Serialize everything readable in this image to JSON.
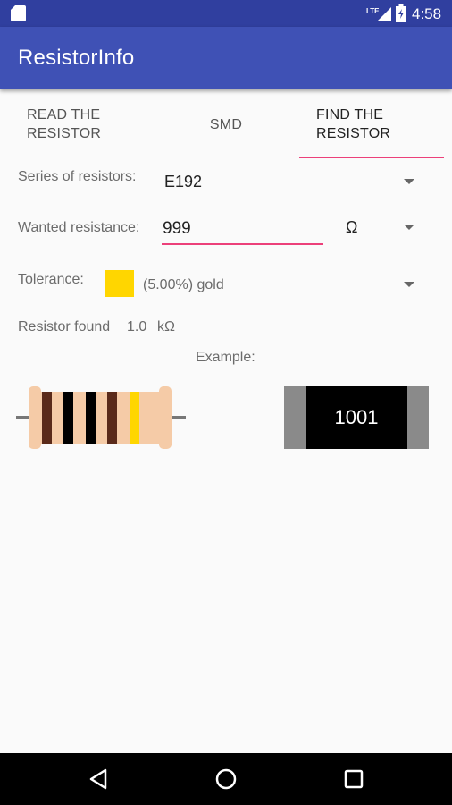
{
  "status_bar": {
    "time": "4:58",
    "network_label": "LTE",
    "icons": [
      "sim-card-icon",
      "lte-signal-icon",
      "battery-icon"
    ]
  },
  "app_bar": {
    "title": "ResistorInfo"
  },
  "tabs": [
    {
      "label": "READ THE RESISTOR",
      "active": false
    },
    {
      "label": "SMD",
      "active": false
    },
    {
      "label": "FIND THE RESISTOR",
      "active": true
    }
  ],
  "form": {
    "series": {
      "label": "Series of resistors:",
      "value": "E192"
    },
    "wanted": {
      "label": "Wanted resistance:",
      "value": "999",
      "unit": "Ω"
    },
    "tolerance": {
      "label": "Tolerance:",
      "value": "(5.00%) gold",
      "swatch_color": "#ffd600"
    }
  },
  "result": {
    "label": "Resistor found",
    "value": "1.0",
    "unit": "kΩ"
  },
  "example": {
    "label": "Example:",
    "resistor": {
      "body_color": "#f5cba7",
      "bands": [
        "#5a2a1a",
        "#000000",
        "#000000",
        "#5a2a1a",
        "#ffd600"
      ]
    },
    "smd_code": "1001"
  },
  "nav_bar": {
    "buttons": [
      "back-icon",
      "home-icon",
      "recents-icon"
    ]
  },
  "colors": {
    "primary": "#3f51b5",
    "primary_dark": "#303f9f",
    "accent": "#ec407a"
  }
}
